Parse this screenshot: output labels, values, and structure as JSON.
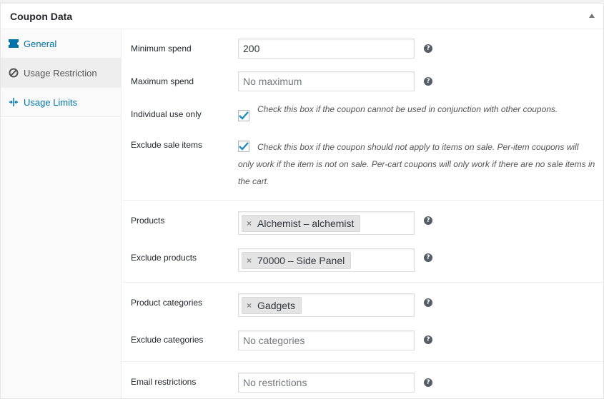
{
  "panel": {
    "title": "Coupon Data"
  },
  "tabs": [
    {
      "label": "General",
      "icon": "ticket-icon"
    },
    {
      "label": "Usage Restriction",
      "icon": "ban-icon"
    },
    {
      "label": "Usage Limits",
      "icon": "limits-icon"
    }
  ],
  "active_tab": "Usage Restriction",
  "fields": {
    "minimum_spend": {
      "label": "Minimum spend",
      "value": "200"
    },
    "maximum_spend": {
      "label": "Maximum spend",
      "placeholder": "No maximum"
    },
    "individual_use": {
      "label": "Individual use only",
      "checked": true,
      "description": "Check this box if the coupon cannot be used in conjunction with other coupons."
    },
    "exclude_sale": {
      "label": "Exclude sale items",
      "checked": true,
      "description": "Check this box if the coupon should not apply to items on sale. Per-item coupons will only work if the item is not on sale. Per-cart coupons will only work if there are no sale items in the cart."
    },
    "products": {
      "label": "Products",
      "tokens": [
        "Alchemist – alchemist"
      ]
    },
    "exclude_products": {
      "label": "Exclude products",
      "tokens": [
        "70000 – Side Panel"
      ]
    },
    "product_categories": {
      "label": "Product categories",
      "tokens": [
        "Gadgets"
      ]
    },
    "exclude_categories": {
      "label": "Exclude categories",
      "placeholder": "No categories"
    },
    "email_restrictions": {
      "label": "Email restrictions",
      "placeholder": "No restrictions"
    }
  },
  "help_glyph": "?",
  "remove_glyph": "×",
  "colors": {
    "link": "#0073aa",
    "active_tab_bg": "#eeeeee",
    "checkmark": "#1e8cbe",
    "help_icon": "#555d66"
  }
}
